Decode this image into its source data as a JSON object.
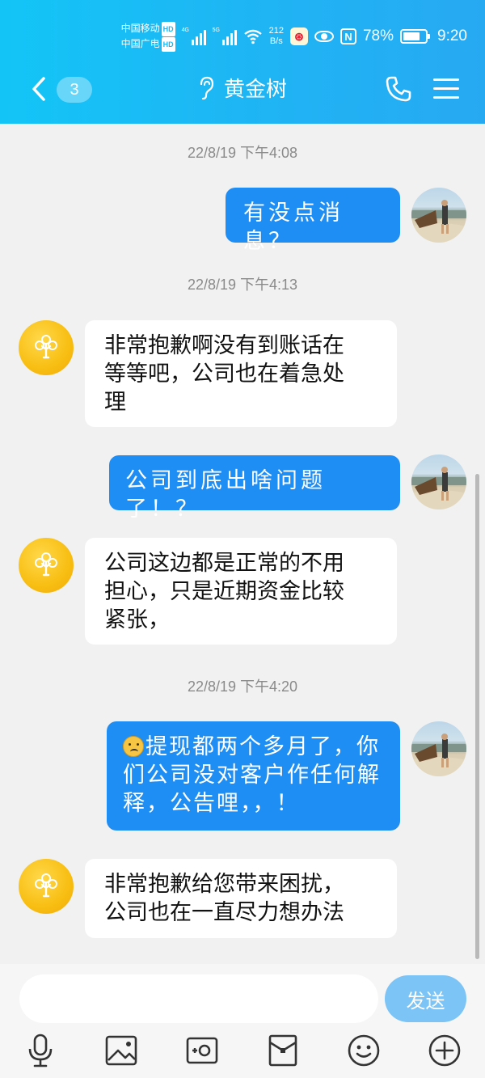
{
  "status": {
    "carrier1": "中国移动",
    "carrier2": "中国广电",
    "hd": "HD",
    "net1": "4G",
    "net2": "5G",
    "speed_value": "212",
    "speed_unit": "B/s",
    "battery": "78%",
    "battery_level": 0.78,
    "time": "9:20"
  },
  "header": {
    "unread": "3",
    "title": "黄金树"
  },
  "chat": [
    {
      "type": "time",
      "text": "22/8/19 下午4:08"
    },
    {
      "type": "out",
      "lines": [
        "有没点消息？"
      ]
    },
    {
      "type": "time",
      "text": "22/8/19 下午4:13"
    },
    {
      "type": "in",
      "lines": [
        "非常抱歉啊没有到账话在",
        "等等吧，公司也在着急处",
        "理"
      ]
    },
    {
      "type": "out",
      "lines": [
        "公司到底出啥问题了！？"
      ]
    },
    {
      "type": "in",
      "lines": [
        "公司这边都是正常的不用",
        "担心，只是近期资金比较",
        "紧张，"
      ]
    },
    {
      "type": "time",
      "text": "22/8/19 下午4:20"
    },
    {
      "type": "out",
      "emoji": "frown-emoji",
      "lines": [
        "提现都两个多月了，你",
        "们公司没对客户作任何解",
        "释，公告哩，，！"
      ]
    },
    {
      "type": "in",
      "lines": [
        "非常抱歉给您带来困扰，",
        "公司也在一直尽力想办法"
      ]
    }
  ],
  "input": {
    "value": "",
    "send_label": "发送"
  },
  "toolbar": [
    "mic-icon",
    "image-icon",
    "camera-icon",
    "red-packet-icon",
    "emoji-icon",
    "plus-icon"
  ],
  "colors": {
    "header": "#1fb4f4",
    "bubble_out": "#1f8ef4",
    "bubble_in": "#ffffff",
    "send": "#7cc3f6",
    "background": "#f1f1f1"
  }
}
